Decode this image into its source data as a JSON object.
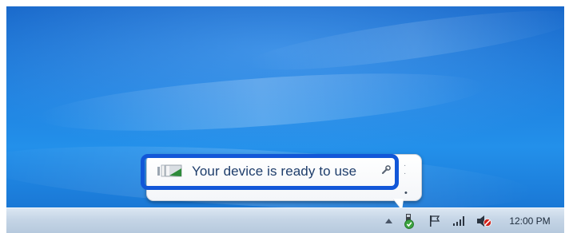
{
  "notification": {
    "message": "Your device is ready to use",
    "icon": "usb-device-icon",
    "options_icon": "wrench-icon"
  },
  "taskbar": {
    "clock": "12:00 PM",
    "tray_icons": [
      "show-hidden-icons-arrow",
      "safely-remove-hardware-icon",
      "action-center-flag-icon",
      "network-signal-icon",
      "volume-muted-icon"
    ]
  },
  "colors": {
    "highlight": "#1257d8",
    "desktop": "#1f82e0"
  }
}
